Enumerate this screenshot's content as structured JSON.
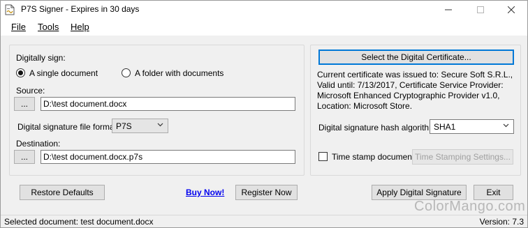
{
  "window": {
    "title": "P7S Signer - Expires in 30 days"
  },
  "menu": {
    "file": "File",
    "tools": "Tools",
    "help": "Help"
  },
  "left_panel": {
    "digitally_sign_label": "Digitally sign:",
    "radio_single": "A single document",
    "radio_folder": "A folder with  documents",
    "radio_selected": "single",
    "source_label": "Source:",
    "browse_source": "...",
    "source_value": "D:\\test document.docx",
    "format_label": "Digital signature file format:",
    "format_value": "P7S",
    "destination_label": "Destination:",
    "browse_destination": "...",
    "destination_value": "D:\\test document.docx.p7s"
  },
  "right_panel": {
    "select_cert_button": "Select the Digital Certificate...",
    "cert_info": "Current certificate was issued to: Secure Soft S.R.L., Valid until: 7/13/2017, Certificate Service Provider: Microsoft Enhanced Cryptographic Provider v1.0, Location: Microsoft Store.",
    "hash_label": "Digital signature hash algorithm:",
    "hash_value": "SHA1",
    "timestamp_label": "Time stamp document",
    "timestamp_checked": false,
    "timestamp_settings_button": "Time Stamping Settings..."
  },
  "footer": {
    "restore_defaults": "Restore Defaults",
    "buy_now": "Buy Now!",
    "register_now": "Register Now",
    "apply_signature": "Apply Digital Signature",
    "exit": "Exit"
  },
  "status": {
    "selected_document": "Selected document: test document.docx",
    "version": "Version: 7.3"
  },
  "watermark": "ColorMango.com"
}
